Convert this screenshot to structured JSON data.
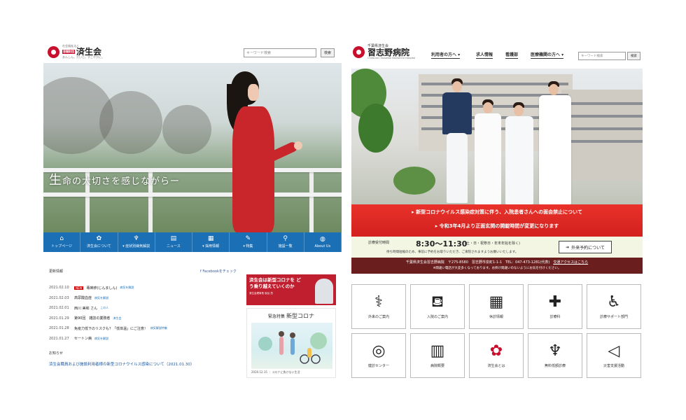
{
  "left": {
    "logo": {
      "line1": "社会福祉法人",
      "line2": "恩賜財団",
      "name": "済生会",
      "sub": "あんしん。だいじ。すこやかに。"
    },
    "search": {
      "placeholder": "キーワード検索",
      "button": "検索"
    },
    "hero": {
      "tagline_first": "生",
      "tagline_rest": "命の大切さを感じながら"
    },
    "nav": [
      {
        "icon": "home-icon",
        "glyph": "⌂",
        "label": "トップページ"
      },
      {
        "icon": "emblem-icon",
        "glyph": "✿",
        "label": "済生会について"
      },
      {
        "icon": "stethoscope-icon",
        "glyph": "♆",
        "label": "▾ 症状別病気解説"
      },
      {
        "icon": "document-icon",
        "glyph": "▤",
        "label": "ニュース"
      },
      {
        "icon": "building-icon",
        "glyph": "▦",
        "label": "▾ 採用情報"
      },
      {
        "icon": "edit-icon",
        "glyph": "✎",
        "label": "▾ 特集"
      },
      {
        "icon": "pin-icon",
        "glyph": "⚲",
        "label": "施設一覧"
      },
      {
        "icon": "globe-icon",
        "glyph": "◍",
        "label": "About Us"
      }
    ],
    "news": {
      "heading": "更新情報",
      "facebook": "Facebookをチェック",
      "items": [
        {
          "date": "2021.02.10",
          "new": "NEW",
          "title": "蕁麻疹(じんましん)",
          "tag": "病気を解説"
        },
        {
          "date": "2021.02.03",
          "title": "高尿酸血症",
          "tag": "病気を解説"
        },
        {
          "date": "2021.02.01",
          "title": "西川 美和 さん",
          "tag": "この人"
        },
        {
          "date": "2021.01.29",
          "title": "第90回　雑誌の業務者",
          "tag": "済生会"
        },
        {
          "date": "2021.01.28",
          "title": "免疫力低下のリスクも？「低体温」にご注意！",
          "tag": "病気解説特集"
        },
        {
          "date": "2021.01.27",
          "title": "セートン病",
          "tag": "病気を解説"
        }
      ]
    },
    "notice": {
      "heading": "お知らせ",
      "text": "済生会職員および施設利用者様の新型コロナウイルス感染について（2021.01.30）"
    },
    "banner1": {
      "title": "済生会は新型コロナを どう乗り越えていくのか",
      "sub": "済生会理事長 炭谷 茂"
    },
    "banner2": {
      "label": "緊急特集",
      "title": "新型コロナ",
      "caption": "2020.12.15 ｜ コロナに負けない生活"
    }
  },
  "right": {
    "logo": {
      "top": "千葉県済生会",
      "name": "習志野病院",
      "sub": "Chiba-ken Saiseikai Narashino Hospital"
    },
    "menu": [
      "利用者の方へ ▾",
      "求人情報",
      "看護部",
      "医療機関の方へ ▾"
    ],
    "search": {
      "placeholder": "キーワード検索",
      "button": "検索"
    },
    "alerts": [
      "▸ 新型コロナウイルス感染症対策に伴う、入院患者さんへの面会禁止について",
      "▸ 令和3年4月より正面玄関の開錠時間が変更になります"
    ],
    "hours": {
      "label": "診療受付時間",
      "time": "8:30〜11:30",
      "note": "(土・日・祝祭日・年末年始を除く)",
      "note2": "待ち時間短縮のため、事前に予約をお取りいただき、ご来院されますようお願いいたします。",
      "button": "外来予約について"
    },
    "address": {
      "line1": "千葉県済生会習志野病院　〒275-8580　習志野市泉町1-1-1　TEL：047-473-1281(代表)",
      "access": "交通アクセスはこちら",
      "line2": "※間違い電話が大変多くなっております。お掛け間違いのないようにお気を付けください。"
    },
    "tiles": [
      {
        "icon": "doctor-icon",
        "glyph": "⚕",
        "label": "外来のご案内"
      },
      {
        "icon": "bed-icon",
        "glyph": "⛾",
        "label": "入院のご案内"
      },
      {
        "icon": "calendar-icon",
        "glyph": "▦",
        "label": "休診情報"
      },
      {
        "icon": "nurse-icon",
        "glyph": "✚",
        "label": "診療科"
      },
      {
        "icon": "wheelchair-icon",
        "glyph": "♿",
        "label": "診療サポート部門"
      },
      {
        "icon": "eye-chart-icon",
        "glyph": "◎",
        "label": "健診センター"
      },
      {
        "icon": "hospital-icon",
        "glyph": "▥",
        "label": "病院概要"
      },
      {
        "icon": "emblem-icon",
        "glyph": "✿",
        "label": "済生会とは"
      },
      {
        "icon": "stethoscope-icon",
        "glyph": "♆",
        "label": "無料低額診療"
      },
      {
        "icon": "megaphone-icon",
        "glyph": "◁",
        "label": "災害支援活動"
      }
    ]
  }
}
